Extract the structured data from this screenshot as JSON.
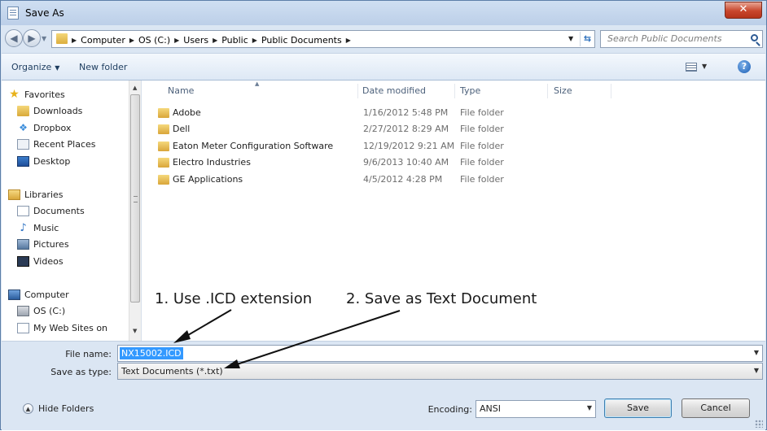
{
  "window": {
    "title": "Save As",
    "close_glyph": "✕"
  },
  "nav": {
    "back_glyph": "◀",
    "forward_glyph": "▶"
  },
  "address": {
    "crumbs": [
      "Computer",
      "OS (C:)",
      "Users",
      "Public",
      "Public Documents"
    ],
    "crumb_partial_visible": "Compu"
  },
  "search": {
    "placeholder": "Search Public Documents"
  },
  "toolbar": {
    "organize_label": "Organize",
    "new_folder_label": "New folder"
  },
  "sidebar": {
    "items": [
      {
        "label": "Favorites",
        "icon": "star-icon"
      },
      {
        "label": "Downloads",
        "icon": "downloads-folder-icon"
      },
      {
        "label": "Dropbox",
        "icon": "dropbox-icon"
      },
      {
        "label": "Recent Places",
        "icon": "recent-places-icon"
      },
      {
        "label": "Desktop",
        "icon": "desktop-icon"
      },
      {
        "label": "Libraries",
        "icon": "libraries-icon"
      },
      {
        "label": "Documents",
        "icon": "documents-icon"
      },
      {
        "label": "Music",
        "icon": "music-icon"
      },
      {
        "label": "Pictures",
        "icon": "pictures-icon"
      },
      {
        "label": "Videos",
        "icon": "videos-icon"
      },
      {
        "label": "Computer",
        "icon": "computer-icon"
      },
      {
        "label": "OS (C:)",
        "icon": "drive-icon"
      },
      {
        "label": "My Web Sites on",
        "icon": "web-folder-icon"
      }
    ]
  },
  "files": {
    "columns": [
      "Name",
      "Date modified",
      "Type",
      "Size"
    ],
    "rows": [
      {
        "name": "Adobe",
        "date": "1/16/2012 5:48 PM",
        "type": "File folder"
      },
      {
        "name": "Dell",
        "date": "2/27/2012 8:29 AM",
        "type": "File folder"
      },
      {
        "name": "Eaton Meter Configuration Software",
        "date": "12/19/2012 9:21 AM",
        "type": "File folder"
      },
      {
        "name": "Electro Industries",
        "date": "9/6/2013 10:40 AM",
        "type": "File folder"
      },
      {
        "name": "GE Applications",
        "date": "4/5/2012 4:28 PM",
        "type": "File folder"
      }
    ]
  },
  "annotations": {
    "note1": "1. Use .ICD extension",
    "note2": "2. Save as Text Document"
  },
  "form": {
    "file_name_label": "File name:",
    "file_name_value": "NX15002.ICD",
    "save_type_label": "Save as type:",
    "save_type_value": "Text Documents (*.txt)",
    "encoding_label": "Encoding:",
    "encoding_value": "ANSI"
  },
  "footer": {
    "hide_folders_label": "Hide Folders",
    "save_label": "Save",
    "cancel_label": "Cancel"
  },
  "colors": {
    "selection": "#3399ff",
    "chrome": "#dbe6f3",
    "close_red": "#c8462c"
  }
}
